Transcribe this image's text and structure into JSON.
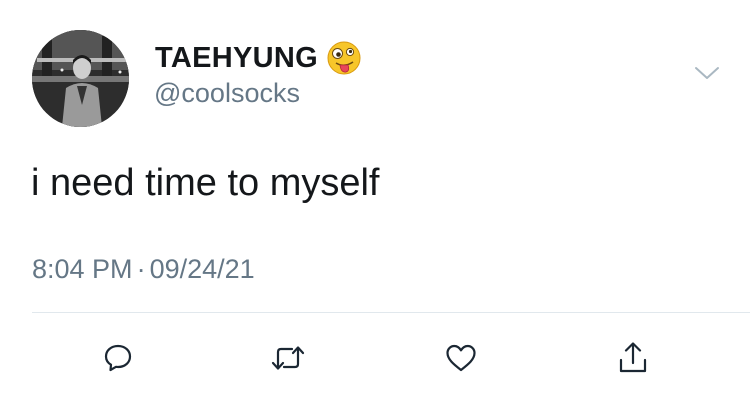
{
  "user": {
    "display_name": "TAEHYUNG",
    "handle": "@coolsocks",
    "avatar_icon": "profile-photo",
    "name_emoji": "zany-face-emoji"
  },
  "tweet": {
    "text": "i need time to myself",
    "time": "8:04 PM",
    "separator": "·",
    "date": "09/24/21"
  },
  "actions": [
    {
      "name": "reply",
      "icon": "speech-bubble-icon"
    },
    {
      "name": "retweet",
      "icon": "retweet-arrows-icon"
    },
    {
      "name": "like",
      "icon": "heart-icon"
    },
    {
      "name": "share",
      "icon": "share-icon"
    }
  ],
  "colors": {
    "text_primary": "#14171a",
    "text_secondary": "#657786",
    "divider": "#e1e8ed",
    "icon": "#1b2733"
  }
}
